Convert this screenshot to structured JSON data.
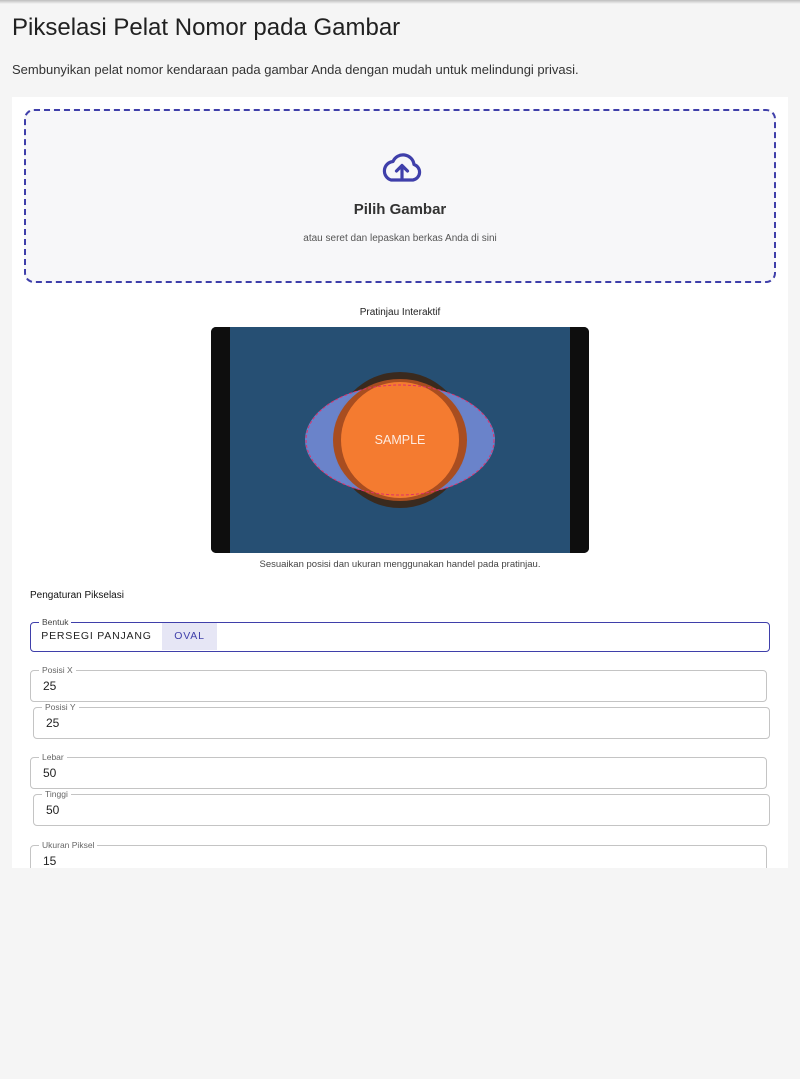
{
  "header": {
    "title": "Pikselasi Pelat Nomor pada Gambar",
    "subtitle": "Sembunyikan pelat nomor kendaraan pada gambar Anda dengan mudah untuk melindungi privasi."
  },
  "upload": {
    "icon": "cloud-upload-icon",
    "title": "Pilih Gambar",
    "hint": "atau seret dan lepaskan berkas Anda di sini"
  },
  "preview": {
    "label": "Pratinjau Interaktif",
    "sample_text": "SAMPLE",
    "hint": "Sesuaikan posisi dan ukuran menggunakan handel pada pratinjau."
  },
  "settings": {
    "title": "Pengaturan Pikselasi",
    "shape": {
      "label": "Bentuk",
      "options": [
        "PERSEGI PANJANG",
        "OVAL"
      ],
      "selected": "OVAL"
    },
    "fields": {
      "pos_x": {
        "label": "Posisi X",
        "value": "25"
      },
      "pos_y": {
        "label": "Posisi Y",
        "value": "25"
      },
      "width": {
        "label": "Lebar",
        "value": "50"
      },
      "height": {
        "label": "Tinggi",
        "value": "50"
      },
      "pixel_size": {
        "label": "Ukuran Piksel",
        "value": "15"
      }
    }
  },
  "colors": {
    "accent": "#3f3faa",
    "preview_bg": "#264f73",
    "sample_orange": "#f47b30",
    "overlay_blue": "#6e86cf",
    "selection_dash": "#e0306a"
  }
}
